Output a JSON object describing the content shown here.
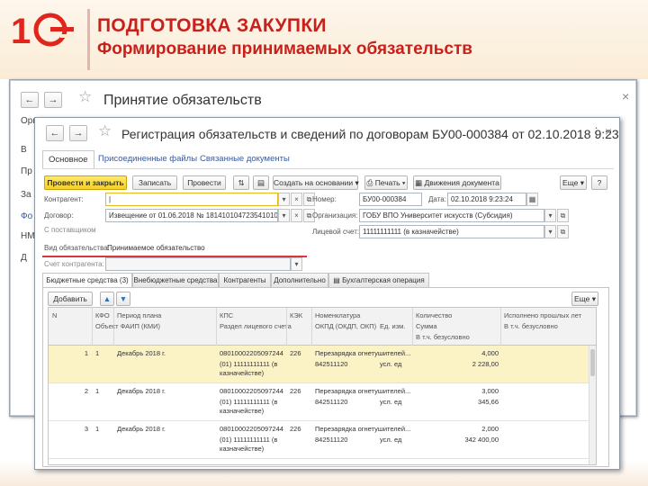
{
  "slide": {
    "title": "ПОДГОТОВКА ЗАКУПКИ",
    "subtitle": "Формирование принимаемых обязательств",
    "logo_text": "1С"
  },
  "back_window": {
    "title": "Принятие обязательств",
    "side_labels": [
      "Орг",
      "В",
      "Пр",
      "За",
      "Фо",
      "НМ",
      "Д"
    ]
  },
  "front_window": {
    "title": "Регистрация обязательств и сведений по договорам БУ00-000384 от 02.10.2018 9:23:",
    "tabs": [
      "Основное",
      "Присоединенные файлы",
      "Связанные документы"
    ],
    "toolbar": {
      "post_close": "Провести и закрыть",
      "save": "Записать",
      "post": "Провести",
      "create_based": "Создать на основании",
      "print": "Печать",
      "movements": "Движения документа",
      "more": "Еще",
      "help": "?"
    },
    "form": {
      "counterparty_label": "Контрагент:",
      "counterparty_value": "|",
      "contract_label": "Договор:",
      "contract_value": "Извещение от 01.06.2018 № 181410104723541010",
      "with_supplier_label": "С поставщиком",
      "obligation_type_label": "Вид обязательства:",
      "obligation_type_value": "Принимаемое обязательство",
      "counterparty_account_label": "Счет контрагента:",
      "number_label": "Номер:",
      "number_value": "БУ00-000384",
      "date_label": "Дата:",
      "date_value": "02.10.2018  9:23:24",
      "organization_label": "Организация:",
      "organization_value": "ГОБУ ВПО Университет искусств (Субсидия)",
      "account_label": "Лицевой счет:",
      "account_value": "11111111111 (в казначействе)"
    },
    "sub_tabs": [
      "Бюджетные средства (3)",
      "Внебюджетные средства",
      "Контрагенты",
      "Дополнительно",
      "Бухгалтерская операция"
    ],
    "table_toolbar": {
      "add": "Добавить",
      "more": "Еще"
    },
    "table": {
      "headers_row1": [
        "N",
        "КФО",
        "Период плана",
        "КПС",
        "КЭК",
        "Номенклатура",
        "Количество",
        "Исполнено прошлых лет"
      ],
      "headers_row2": [
        "Объект ФАИП (КМИ)",
        "Раздел лицевого счета",
        "ОКПД (ОКДП, ОКП)",
        "Ед. изм.",
        "Сумма",
        "В т.ч. безусловно"
      ],
      "headers_row3": [
        "В т.ч. безусловно"
      ],
      "rows": [
        {
          "n": "1",
          "kfo": "1",
          "period": "Декабрь 2018 г.",
          "kps": "08010002205097244",
          "kek": "226",
          "item": "Перезарядка огнетушителей...",
          "qty": "4,000",
          "section": "(01) 11111111111 (в казначействе)",
          "okpd": "842511120",
          "unit": "усл. ед",
          "sum": "2 228,00"
        },
        {
          "n": "2",
          "kfo": "1",
          "period": "Декабрь 2018 г.",
          "kps": "08010002205097244",
          "kek": "226",
          "item": "Перезарядка огнетушителей...",
          "qty": "3,000",
          "section": "(01) 11111111111 (в казначействе)",
          "okpd": "842511120",
          "unit": "усл. ед",
          "sum": "345,66"
        },
        {
          "n": "3",
          "kfo": "1",
          "period": "Декабрь 2018 г.",
          "kps": "08010002205097244",
          "kek": "226",
          "item": "Перезарядка огнетушителей...",
          "qty": "2,000",
          "section": "(01) 11111111111 (в казначействе)",
          "okpd": "842511120",
          "unit": "усл. ед",
          "sum": "342 400,00"
        }
      ]
    }
  },
  "colors": {
    "title_red": "#c8201b",
    "primary_button": "#f5d02a",
    "selected_row": "#fbf2c6",
    "link_blue": "#3a5a99"
  }
}
